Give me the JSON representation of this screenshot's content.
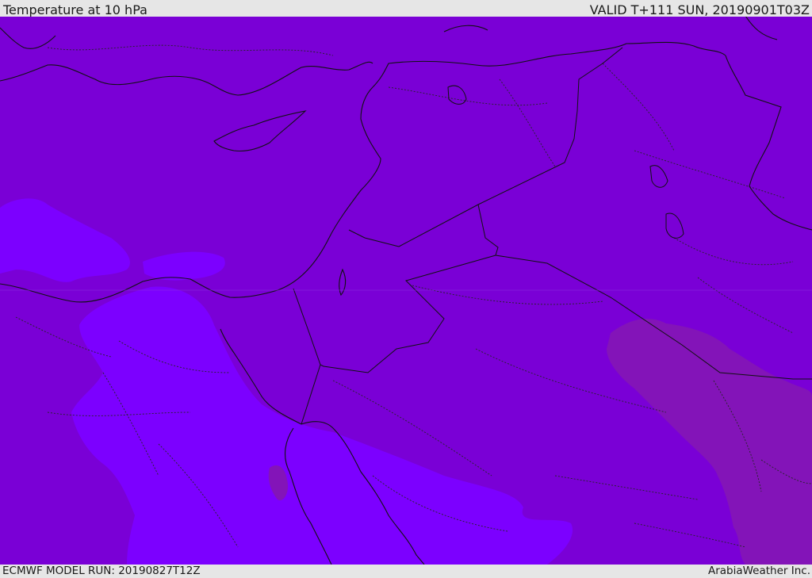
{
  "header": {
    "title": "Temperature at 10 hPa",
    "valid_time": "VALID T+111 SUN, 20190901T03Z"
  },
  "footer": {
    "model_run": "ECMWF MODEL RUN: 20190827T12Z",
    "credit": "ArabiaWeather Inc."
  },
  "map": {
    "colors": {
      "background_field": "#7a00d6",
      "cold_field": "#7c00ff",
      "warm_field": "#8314b8",
      "coastline": "#111111",
      "borders": "#222222"
    }
  }
}
